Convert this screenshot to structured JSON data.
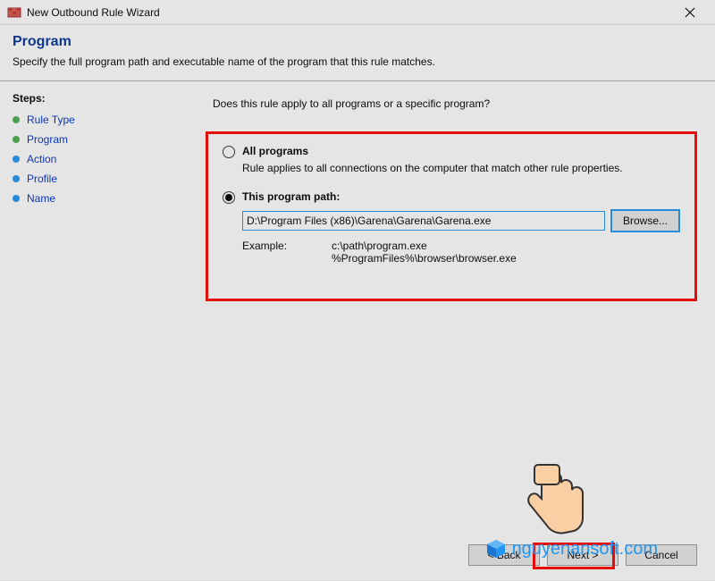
{
  "titlebar": {
    "text": "New Outbound Rule Wizard"
  },
  "header": {
    "title": "Program",
    "subtitle": "Specify the full program path and executable name of the program that this rule matches."
  },
  "sidebar": {
    "title": "Steps:",
    "items": [
      "Rule Type",
      "Program",
      "Action",
      "Profile",
      "Name"
    ]
  },
  "main": {
    "question": "Does this rule apply to all programs or a specific program?",
    "opt1": {
      "label": "All programs",
      "desc": "Rule applies to all connections on the computer that match other rule properties."
    },
    "opt2": {
      "label": "This program path:",
      "path": "D:\\Program Files (x86)\\Garena\\Garena\\Garena.exe",
      "browse": "Browse...",
      "example_label": "Example:",
      "example_text": "c:\\path\\program.exe\n%ProgramFiles%\\browser\\browser.exe"
    }
  },
  "buttons": {
    "back": "< Back",
    "next": "Next >",
    "cancel": "Cancel"
  },
  "watermark": "nguyenansoft.com"
}
